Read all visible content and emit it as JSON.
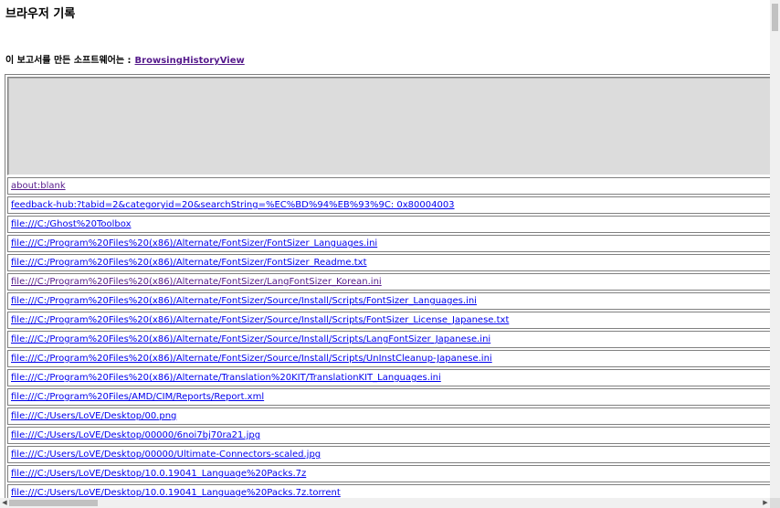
{
  "page": {
    "title": "브라우저 기록",
    "credit_prefix": "이 보고서를 만든 소프트웨어는 :",
    "credit_link": "BrowsingHistoryView"
  },
  "rows": [
    {
      "url": "about:blank",
      "visited": true
    },
    {
      "url": "feedback-hub:?tabid=2&categoryid=20&searchString=%EC%BD%94%EB%93%9C: 0x80004003",
      "visited": false
    },
    {
      "url": "file:///C:/Ghost%20Toolbox",
      "visited": false
    },
    {
      "url": "file:///C:/Program%20Files%20(x86)/Alternate/FontSizer/FontSizer_Languages.ini",
      "visited": false
    },
    {
      "url": "file:///C:/Program%20Files%20(x86)/Alternate/FontSizer/FontSizer_Readme.txt",
      "visited": false
    },
    {
      "url": "file:///C:/Program%20Files%20(x86)/Alternate/FontSizer/LangFontSizer_Korean.ini",
      "visited": true
    },
    {
      "url": "file:///C:/Program%20Files%20(x86)/Alternate/FontSizer/Source/Install/Scripts/FontSizer_Languages.ini",
      "visited": false
    },
    {
      "url": "file:///C:/Program%20Files%20(x86)/Alternate/FontSizer/Source/Install/Scripts/FontSizer_License_Japanese.txt",
      "visited": false
    },
    {
      "url": "file:///C:/Program%20Files%20(x86)/Alternate/FontSizer/Source/Install/Scripts/LangFontSizer_Japanese.ini",
      "visited": false
    },
    {
      "url": "file:///C:/Program%20Files%20(x86)/Alternate/FontSizer/Source/Install/Scripts/UnInstCleanup-Japanese.ini",
      "visited": false
    },
    {
      "url": "file:///C:/Program%20Files%20(x86)/Alternate/Translation%20KIT/TranslationKIT_Languages.ini",
      "visited": false
    },
    {
      "url": "file:///C:/Program%20Files/AMD/CIM/Reports/Report.xml",
      "visited": false
    },
    {
      "url": "file:///C:/Users/LoVE/Desktop/00.png",
      "visited": false
    },
    {
      "url": "file:///C:/Users/LoVE/Desktop/00000/6noi7bj70ra21.jpg",
      "visited": false
    },
    {
      "url": "file:///C:/Users/LoVE/Desktop/00000/Ultimate-Connectors-scaled.jpg",
      "visited": false
    },
    {
      "url": "file:///C:/Users/LoVE/Desktop/10.0.19041_Language%20Packs.7z",
      "visited": false
    },
    {
      "url": "file:///C:/Users/LoVE/Desktop/10.0.19041_Language%20Packs.7z.torrent",
      "visited": false
    }
  ],
  "scrollbar": {
    "left_arrow": "◀",
    "right_arrow": "▶"
  },
  "colors": {
    "link": "#0000ee",
    "visited_link": "#551a8b",
    "header_bg": "#dcdcdc"
  }
}
